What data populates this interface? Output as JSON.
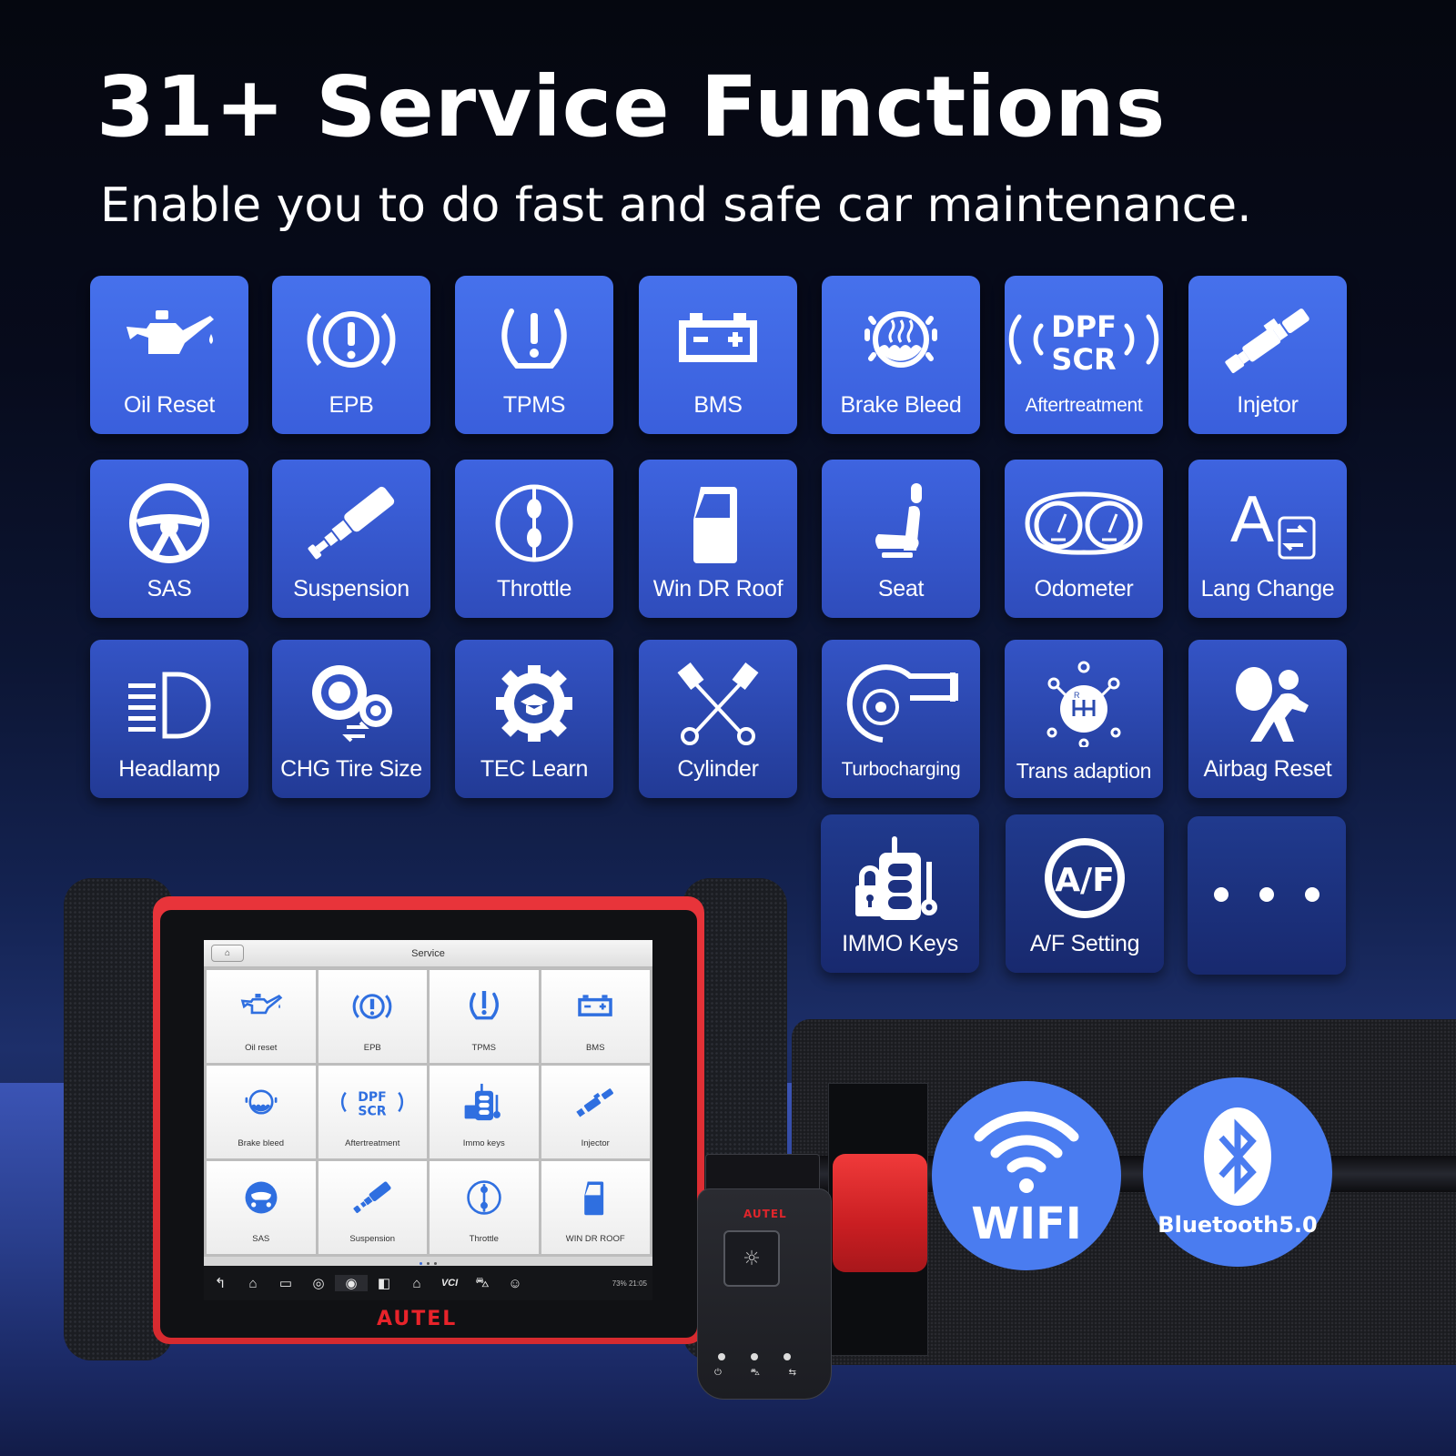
{
  "header": {
    "title": "31+ Service Functions",
    "subtitle": "Enable you to do fast and safe car maintenance."
  },
  "functions": [
    {
      "label": "Oil Reset",
      "icon": "oil-can-icon"
    },
    {
      "label": "EPB",
      "icon": "parking-brake-icon"
    },
    {
      "label": "TPMS",
      "icon": "tire-pressure-icon"
    },
    {
      "label": "BMS",
      "icon": "battery-icon"
    },
    {
      "label": "Brake Bleed",
      "icon": "brake-fluid-icon"
    },
    {
      "label": "Aftertreatment",
      "icon": "dpf-scr-icon",
      "icon_text": [
        "DPF",
        "SCR"
      ]
    },
    {
      "label": "Injetor",
      "icon": "injector-icon"
    },
    {
      "label": "SAS",
      "icon": "steering-wheel-icon"
    },
    {
      "label": "Suspension",
      "icon": "suspension-icon"
    },
    {
      "label": "Throttle",
      "icon": "throttle-icon"
    },
    {
      "label": "Win DR Roof",
      "icon": "car-door-icon"
    },
    {
      "label": "Seat",
      "icon": "seat-icon"
    },
    {
      "label": "Odometer",
      "icon": "odometer-icon"
    },
    {
      "label": "Lang Change",
      "icon": "language-icon",
      "icon_text": [
        "A"
      ]
    },
    {
      "label": "Headlamp",
      "icon": "headlamp-icon"
    },
    {
      "label": "CHG Tire Size",
      "icon": "tire-size-icon"
    },
    {
      "label": "TEC Learn",
      "icon": "tec-learn-icon"
    },
    {
      "label": "Cylinder",
      "icon": "cylinder-icon"
    },
    {
      "label": "Turbocharging",
      "icon": "turbo-icon"
    },
    {
      "label": "Trans adaption",
      "icon": "gearshift-icon",
      "icon_text": [
        "R"
      ]
    },
    {
      "label": "Airbag Reset",
      "icon": "airbag-icon"
    },
    {
      "label": "IMMO Keys",
      "icon": "immo-key-icon"
    },
    {
      "label": "A/F Setting",
      "icon": "air-fuel-icon",
      "icon_text": [
        "A/F"
      ]
    },
    {
      "label": "",
      "icon": "more-dots-icon"
    }
  ],
  "tablet": {
    "screen_title": "Service",
    "home_icon": "home-m-icon",
    "items": [
      {
        "label": "Oil reset",
        "icon": "oil-can-icon"
      },
      {
        "label": "EPB",
        "icon": "parking-brake-icon"
      },
      {
        "label": "TPMS",
        "icon": "tire-pressure-icon"
      },
      {
        "label": "BMS",
        "icon": "battery-icon"
      },
      {
        "label": "Brake bleed",
        "icon": "brake-fluid-icon"
      },
      {
        "label": "Aftertreatment",
        "icon": "dpf-scr-icon"
      },
      {
        "label": "Immo keys",
        "icon": "immo-key-icon"
      },
      {
        "label": "Injector",
        "icon": "injector-icon"
      },
      {
        "label": "SAS",
        "icon": "steering-wheel-icon"
      },
      {
        "label": "Suspension",
        "icon": "suspension-icon"
      },
      {
        "label": "Throttle",
        "icon": "throttle-icon"
      },
      {
        "label": "WIN DR ROOF",
        "icon": "car-door-icon"
      }
    ],
    "page_indicator": {
      "pages": 3,
      "current": 1
    },
    "navbar": [
      {
        "icon": "back-icon",
        "glyph": "↰"
      },
      {
        "icon": "home-icon",
        "glyph": "⌂"
      },
      {
        "icon": "recent-apps-icon",
        "glyph": "▭"
      },
      {
        "icon": "browser-icon",
        "glyph": "◎"
      },
      {
        "icon": "camera-icon",
        "glyph": "◉"
      },
      {
        "icon": "display-icon",
        "glyph": "◧"
      },
      {
        "icon": "home-m-icon",
        "glyph": "⌂"
      },
      {
        "icon": "vci-icon",
        "glyph": "VCI"
      },
      {
        "icon": "car-icon",
        "glyph": "⛍"
      },
      {
        "icon": "remote-expert-icon",
        "glyph": "☺"
      }
    ],
    "status": "73% 21:05",
    "brand": "AUTEL"
  },
  "vci": {
    "brand": "AUTEL",
    "indicators": [
      "power-icon",
      "car-icon",
      "connection-icon"
    ],
    "indicator_glyphs": [
      "⏻",
      "⛍",
      "⇆"
    ]
  },
  "badges": {
    "wifi": {
      "label": "WIFI",
      "icon": "wifi-icon"
    },
    "bluetooth": {
      "label": "Bluetooth5.0",
      "icon": "bluetooth-icon"
    }
  },
  "colors": {
    "tile_blue": "#4671ec",
    "tile_navy": "#18296e",
    "badge_blue": "#4a7cf0",
    "autel_red": "#e8232a",
    "screen_icon_blue": "#2f6fe0"
  }
}
